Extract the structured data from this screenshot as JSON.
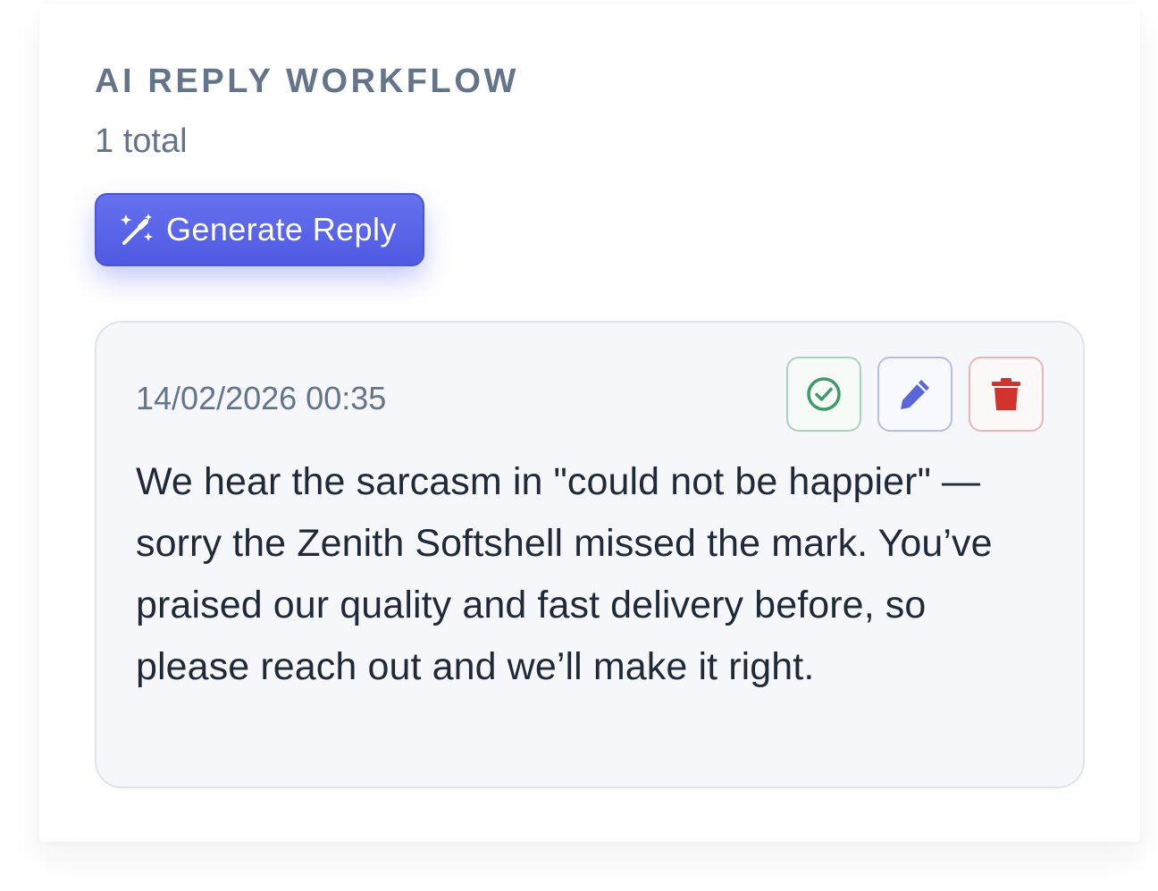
{
  "section": {
    "title": "AI REPLY WORKFLOW",
    "count_label": "1 total"
  },
  "toolbar": {
    "generate_label": "Generate Reply",
    "generate_icon": "magic-wand-sparkles-icon"
  },
  "replies": [
    {
      "timestamp": "14/02/2026 00:35",
      "text": "We hear the sarcasm in \"could not be happier\" — sorry the Zenith Softshell missed the mark. You’ve praised our quality and fast delivery before, so please reach out and we’ll make it right.",
      "actions": {
        "approve_icon": "check-circle-icon",
        "edit_icon": "pencil-icon",
        "delete_icon": "trash-icon"
      }
    }
  ],
  "colors": {
    "accent": "#5b66e8",
    "approve": "#3f9a6b",
    "edit": "#5a67d8",
    "delete": "#d0342c",
    "muted_text": "#64748b",
    "body_text": "#1f2937"
  }
}
